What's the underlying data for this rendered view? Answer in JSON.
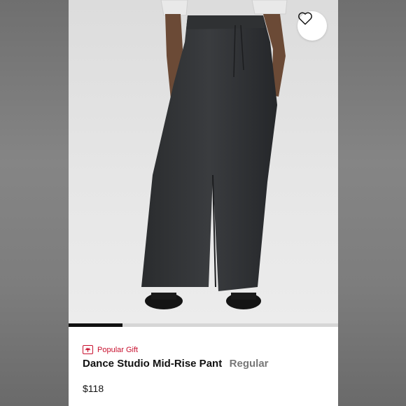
{
  "product": {
    "badge_label": "Popular Gift",
    "title": "Dance Studio Mid-Rise Pant",
    "fit": "Regular",
    "price": "$118"
  },
  "gallery": {
    "progress_fraction": 0.2
  },
  "icons": {
    "favorite": "heart-outline-icon",
    "badge": "gift-icon"
  },
  "colors": {
    "accent": "#c8102e",
    "text": "#111111",
    "muted": "#777777"
  }
}
